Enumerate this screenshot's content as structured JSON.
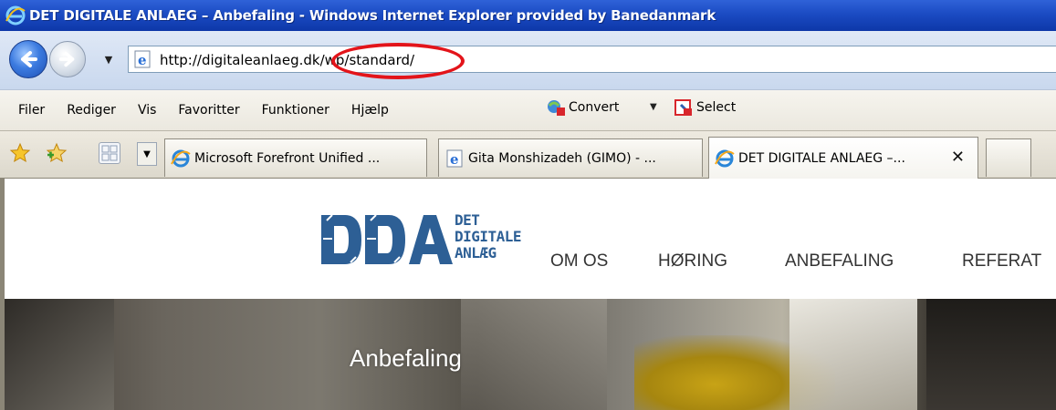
{
  "window": {
    "title": "DET DIGITALE ANLAEG – Anbefaling - Windows Internet Explorer provided by Banedanmark"
  },
  "addressbar": {
    "url": "http://digitaleanlaeg.dk/wp/standard/"
  },
  "menu": {
    "items": [
      "Filer",
      "Rediger",
      "Vis",
      "Favoritter",
      "Funktioner",
      "Hjælp"
    ],
    "convert_label": "Convert",
    "select_label": "Select"
  },
  "tabs": [
    {
      "label": "Microsoft Forefront Unified ..."
    },
    {
      "label": "Gita Monshizadeh (GIMO) - ..."
    },
    {
      "label": "DET DIGITALE ANLAEG –..."
    },
    {
      "label": ""
    }
  ],
  "site": {
    "logo_text": "DDA",
    "logo_words": [
      "DET",
      "DIGITALE",
      "ANLÆG"
    ],
    "nav": [
      "OM OS",
      "HØRING",
      "ANBEFALING",
      "REFERAT"
    ],
    "hero_title": "Anbefaling"
  },
  "colors": {
    "titlebar": "#1b4bc3",
    "logo_blue": "#2d5f95",
    "highlight": "#e3141a"
  },
  "icons": {
    "back": "back-arrow-icon",
    "forward": "forward-arrow-icon",
    "page": "ie-page-icon",
    "favorites": "star-icon",
    "add_favorites": "add-star-icon",
    "quick_tabs": "quick-tabs-icon",
    "close_tab": "close-icon"
  }
}
